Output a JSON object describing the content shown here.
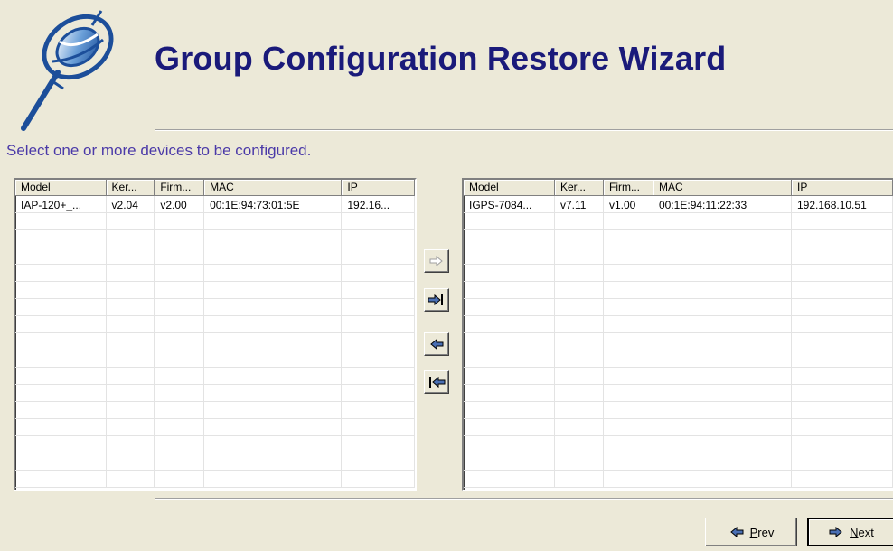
{
  "window": {
    "title": "Group Configuration Restore Wizard"
  },
  "instruction": "Select one or more devices to be configured.",
  "columns": [
    "Model",
    "Ker...",
    "Firm...",
    "MAC",
    "IP"
  ],
  "source_list": {
    "rows": [
      [
        "IAP-120+_...",
        "v2.04",
        "v2.00",
        "00:1E:94:73:01:5E",
        "192.16..."
      ]
    ]
  },
  "target_list": {
    "rows": [
      [
        "IGPS-7084...",
        "v7.11",
        "v1.00",
        "00:1E:94:11:22:33",
        "192.168.10.51"
      ]
    ]
  },
  "transfer_buttons": [
    {
      "icon": "arrow-right-icon",
      "state": "disabled"
    },
    {
      "icon": "arrow-right-all-icon",
      "state": "enabled"
    },
    {
      "icon": "arrow-left-icon",
      "state": "enabled"
    },
    {
      "icon": "arrow-left-all-icon",
      "state": "enabled"
    }
  ],
  "buttons": {
    "prev": {
      "label_first": "P",
      "label_rest": "rev",
      "icon": "arrow-left-icon"
    },
    "next": {
      "label_first": "N",
      "label_rest": "ext",
      "icon": "arrow-right-icon"
    }
  },
  "colors": {
    "background": "#ECE9D8",
    "title": "#1a1a7a",
    "instruction": "#4b3aa8"
  }
}
